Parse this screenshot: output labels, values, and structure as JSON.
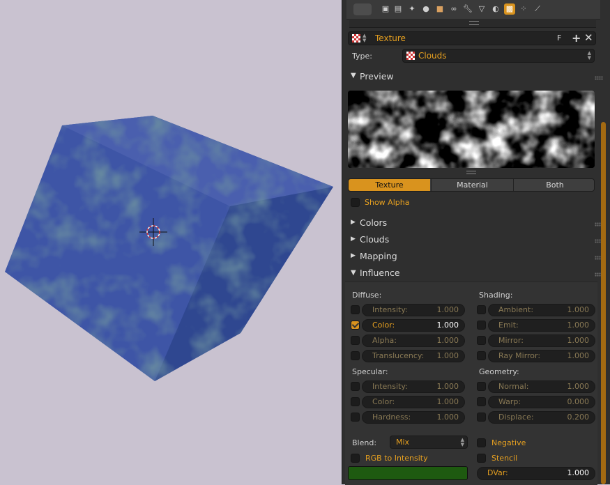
{
  "panel": {
    "texture_name": "Texture",
    "fake_user": "F",
    "type_label": "Type:",
    "type_value": "Clouds",
    "preview_label": "Preview",
    "tabs": [
      "Texture",
      "Material",
      "Both"
    ],
    "active_tab": "Texture",
    "show_alpha": "Show Alpha",
    "sections": [
      "Colors",
      "Clouds",
      "Mapping",
      "Influence"
    ],
    "diffuse": {
      "title": "Diffuse:",
      "rows": [
        {
          "label": "Intensity:",
          "value": "1.000",
          "checked": false
        },
        {
          "label": "Color:",
          "value": "1.000",
          "checked": true
        },
        {
          "label": "Alpha:",
          "value": "1.000",
          "checked": false
        },
        {
          "label": "Translucency:",
          "value": "1.000",
          "checked": false
        }
      ]
    },
    "shading": {
      "title": "Shading:",
      "rows": [
        {
          "label": "Ambient:",
          "value": "1.000"
        },
        {
          "label": "Emit:",
          "value": "1.000"
        },
        {
          "label": "Mirror:",
          "value": "1.000"
        },
        {
          "label": "Ray Mirror:",
          "value": "1.000"
        }
      ]
    },
    "specular": {
      "title": "Specular:",
      "rows": [
        {
          "label": "Intensity:",
          "value": "1.000"
        },
        {
          "label": "Color:",
          "value": "1.000"
        },
        {
          "label": "Hardness:",
          "value": "1.000"
        }
      ]
    },
    "geometry": {
      "title": "Geometry:",
      "rows": [
        {
          "label": "Normal:",
          "value": "1.000"
        },
        {
          "label": "Warp:",
          "value": "0.000"
        },
        {
          "label": "Displace:",
          "value": "0.200"
        }
      ]
    },
    "blend_label": "Blend:",
    "blend_value": "Mix",
    "negative": "Negative",
    "rgb_to_intensity": "RGB to Intensity",
    "stencil": "Stencil",
    "dvar_label": "DVar:",
    "dvar_value": "1.000",
    "color_swatch": "#1e5a10"
  },
  "colors": {
    "accent": "#d9931e",
    "cube": "#3f56a8"
  }
}
